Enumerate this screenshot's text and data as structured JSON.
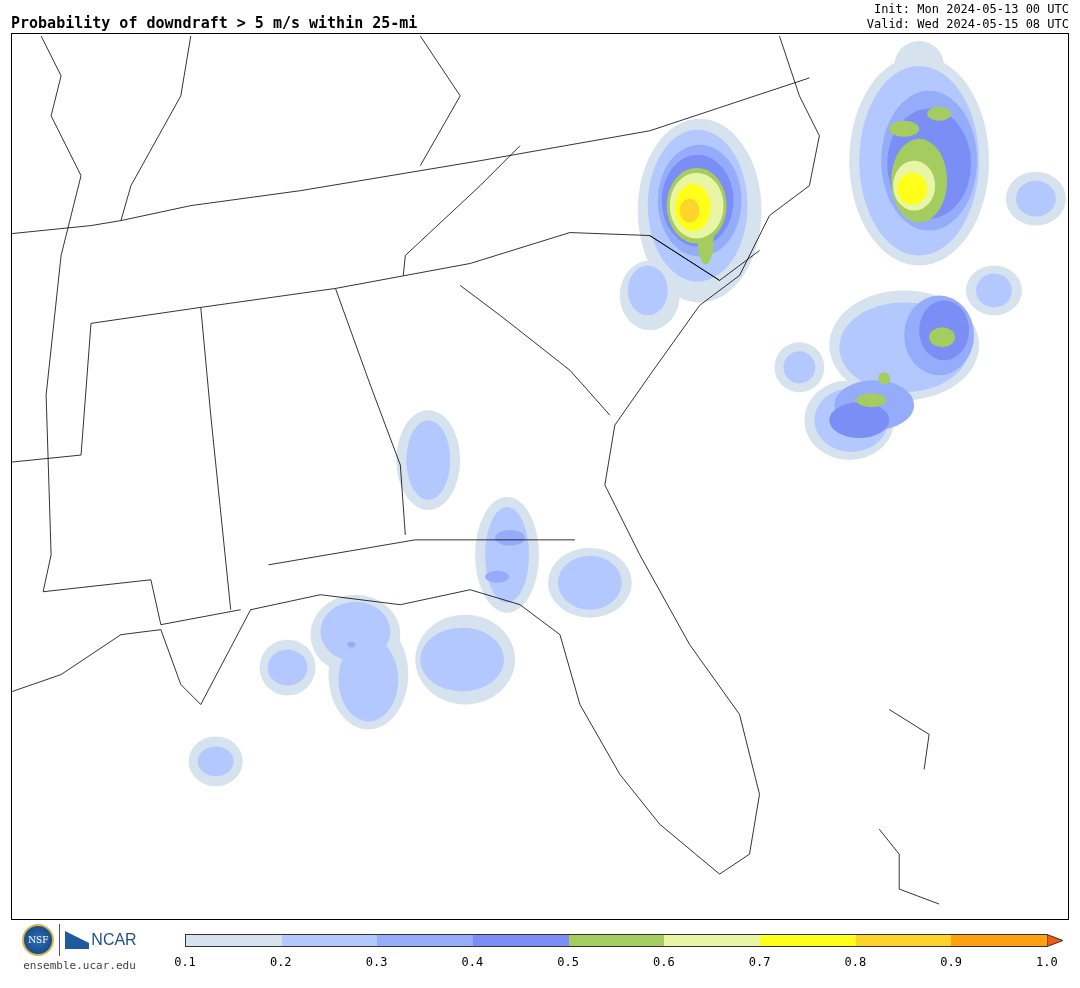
{
  "header": {
    "title": "Probability of downdraft > 5 m/s within 25-mi",
    "init": "Init: Mon 2024-05-13 00 UTC",
    "valid": "Valid: Wed 2024-05-15 08 UTC"
  },
  "footer": {
    "nsf_logo": "NSF",
    "ncar_logo": "NCAR",
    "site": "ensemble.ucar.edu"
  },
  "colorbar": {
    "bins": [
      {
        "color": "#d6e2ee"
      },
      {
        "color": "#b3c8ff"
      },
      {
        "color": "#95acfa"
      },
      {
        "color": "#7b8ef5"
      },
      {
        "color": "#a4cc5e"
      },
      {
        "color": "#e8f5a5"
      },
      {
        "color": "#ffff1a"
      },
      {
        "color": "#ffd42a"
      },
      {
        "color": "#ffa010"
      }
    ],
    "labels": [
      "0.1",
      "0.2",
      "0.3",
      "0.4",
      "0.5",
      "0.6",
      "0.7",
      "0.8",
      "0.9",
      "1.0"
    ]
  }
}
